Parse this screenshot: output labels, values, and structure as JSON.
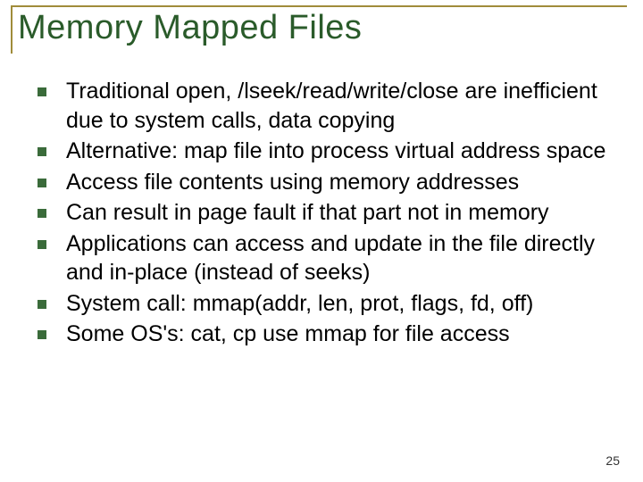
{
  "slide": {
    "title": "Memory Mapped Files",
    "bullets": [
      "Traditional open, /lseek/read/write/close are inefficient due to system calls, data copying",
      "Alternative: map file into process virtual address space",
      "Access file contents using memory addresses",
      "Can result in page fault if that part not in memory",
      "Applications can access and update in the file directly and in-place (instead of seeks)",
      "System call: mmap(addr, len, prot, flags, fd, off)",
      "Some OS's: cat, cp use mmap for file access"
    ],
    "page_number": "25"
  }
}
